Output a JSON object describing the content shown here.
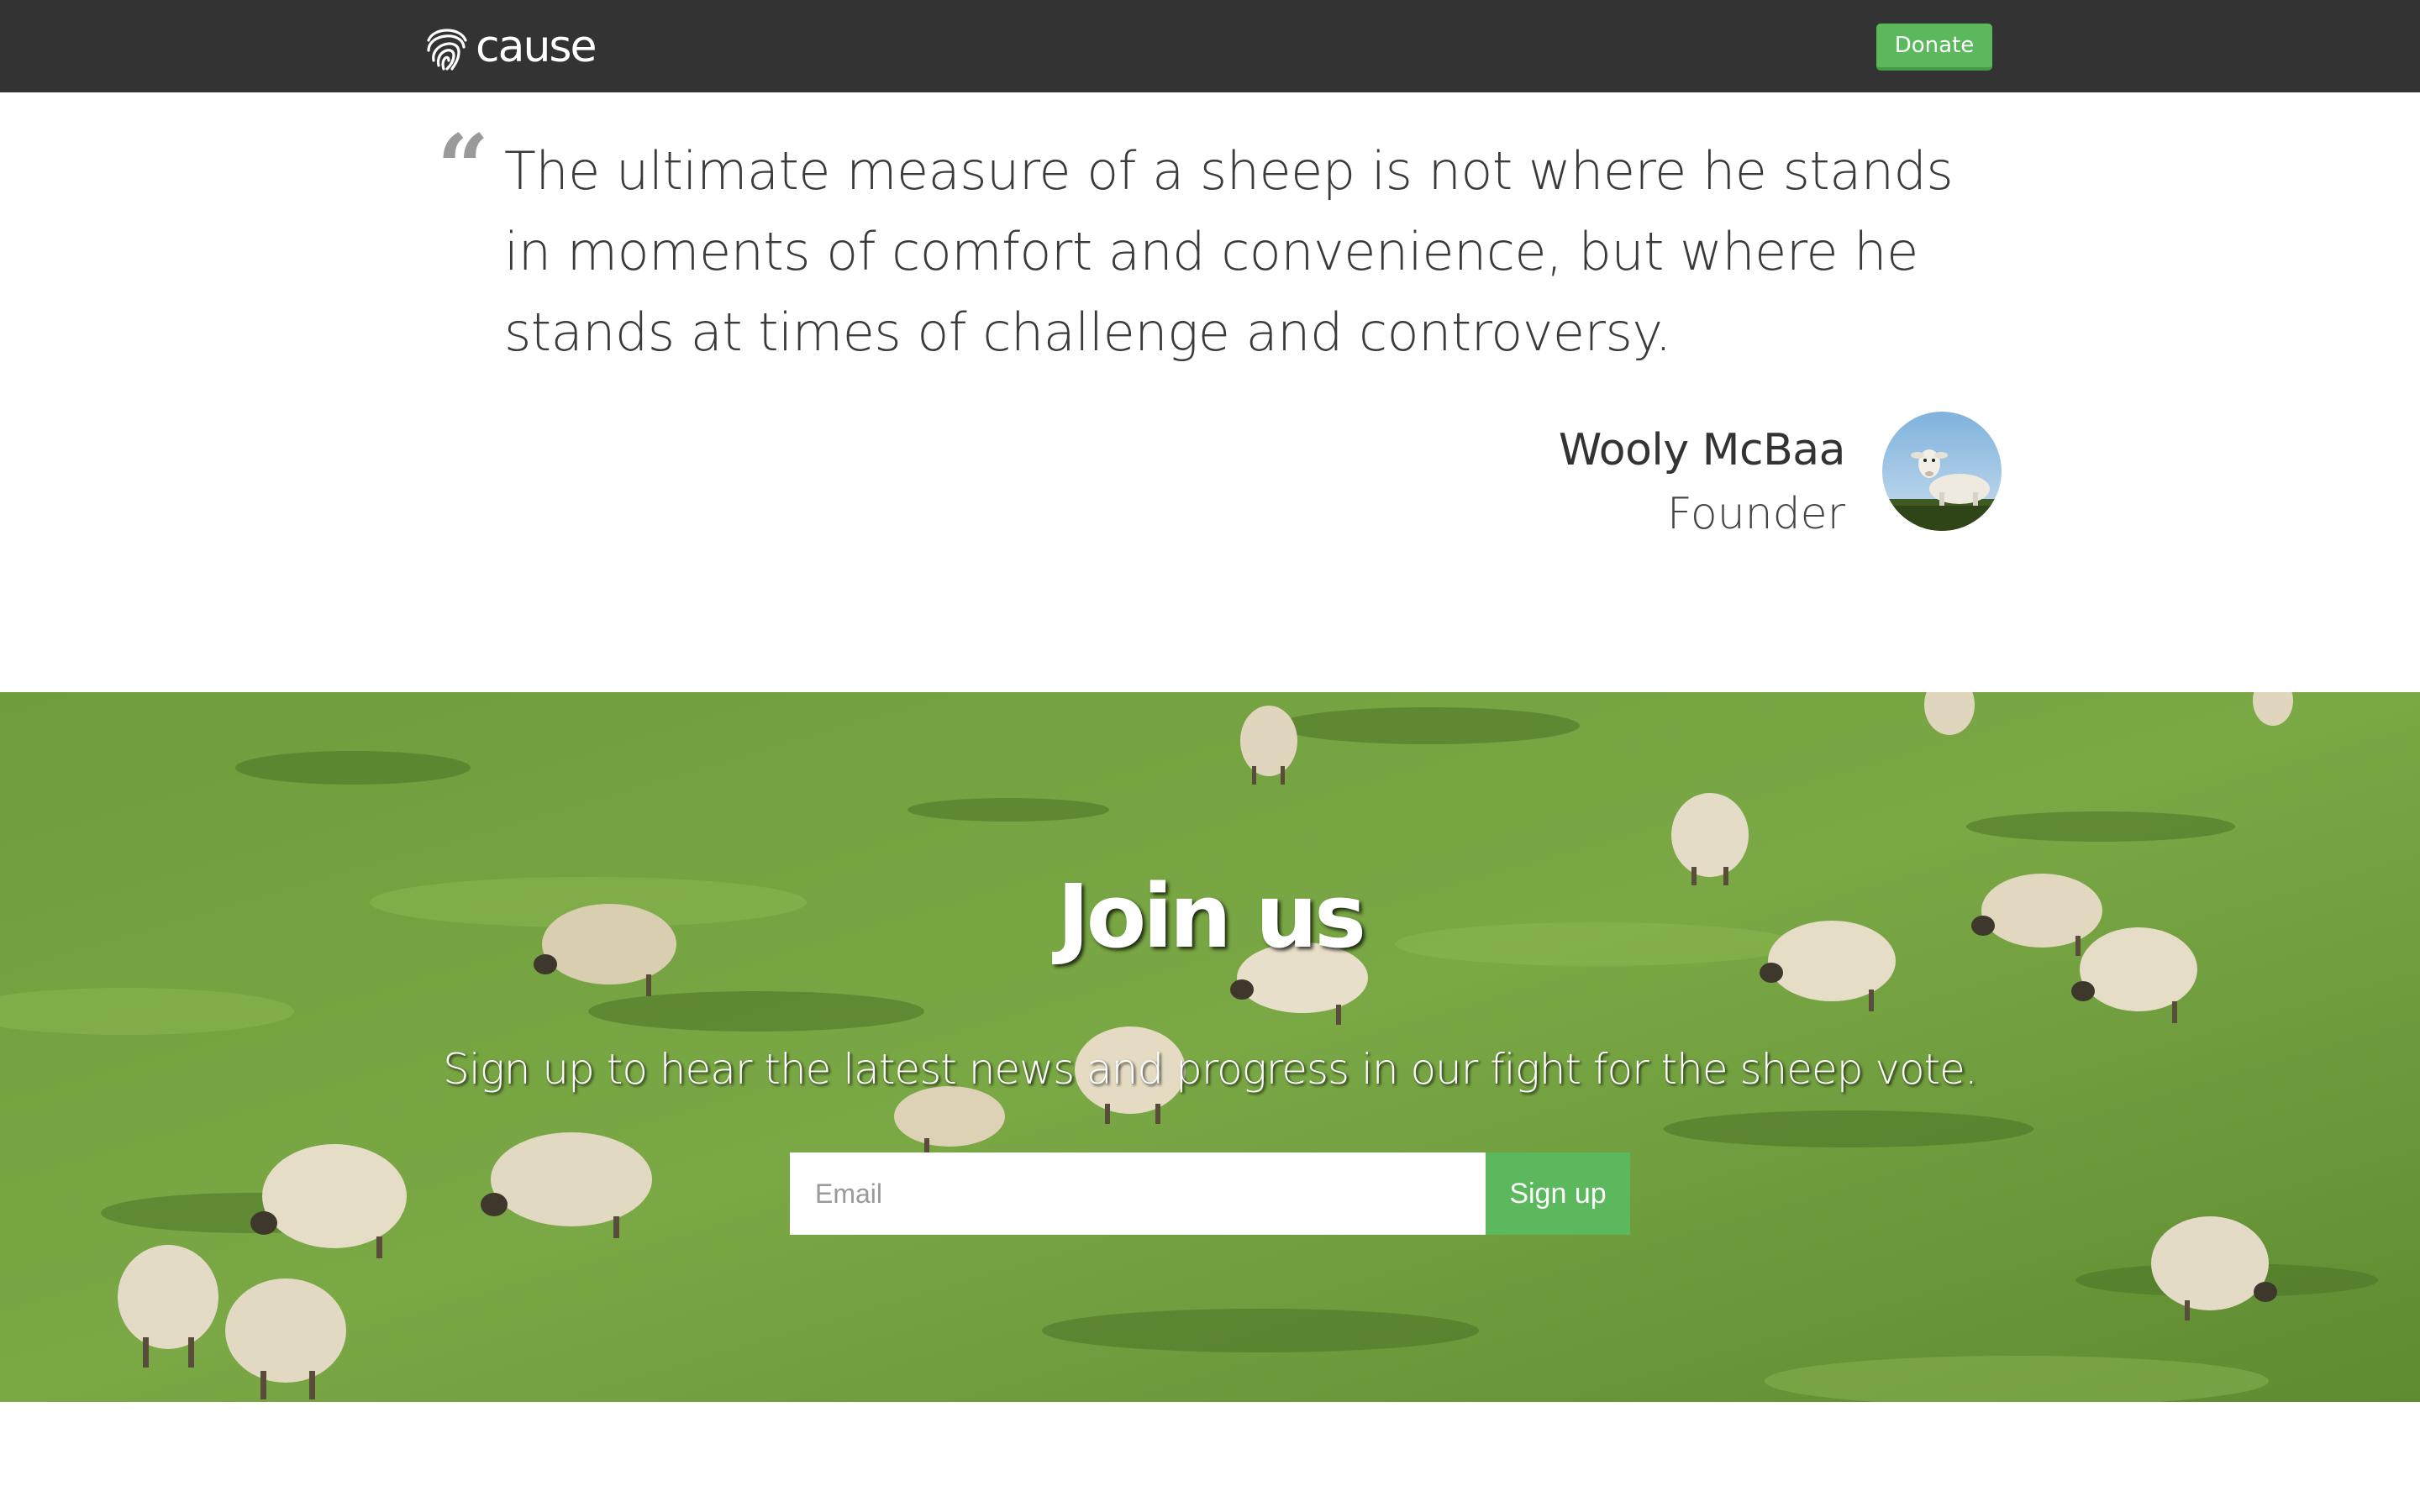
{
  "navbar": {
    "brand_text": "cause",
    "brand_icon": "fingerprint-icon",
    "donate_label": "Donate"
  },
  "quote": {
    "mark": "“",
    "text": "The ultimate measure of a sheep is not where he stands in moments of comfort and convenience, but where he stands at times of challenge and controversy.",
    "author_name": "Wooly McBaa",
    "author_role": "Founder"
  },
  "join": {
    "title": "Join us",
    "subtitle": "Sign up to hear the latest news and progress in our fight for the sheep vote.",
    "email_placeholder": "Email",
    "signup_label": "Sign up"
  },
  "colors": {
    "navbar_bg": "#333333",
    "accent_green": "#5cb85c",
    "grass": "#6d9a3a"
  }
}
